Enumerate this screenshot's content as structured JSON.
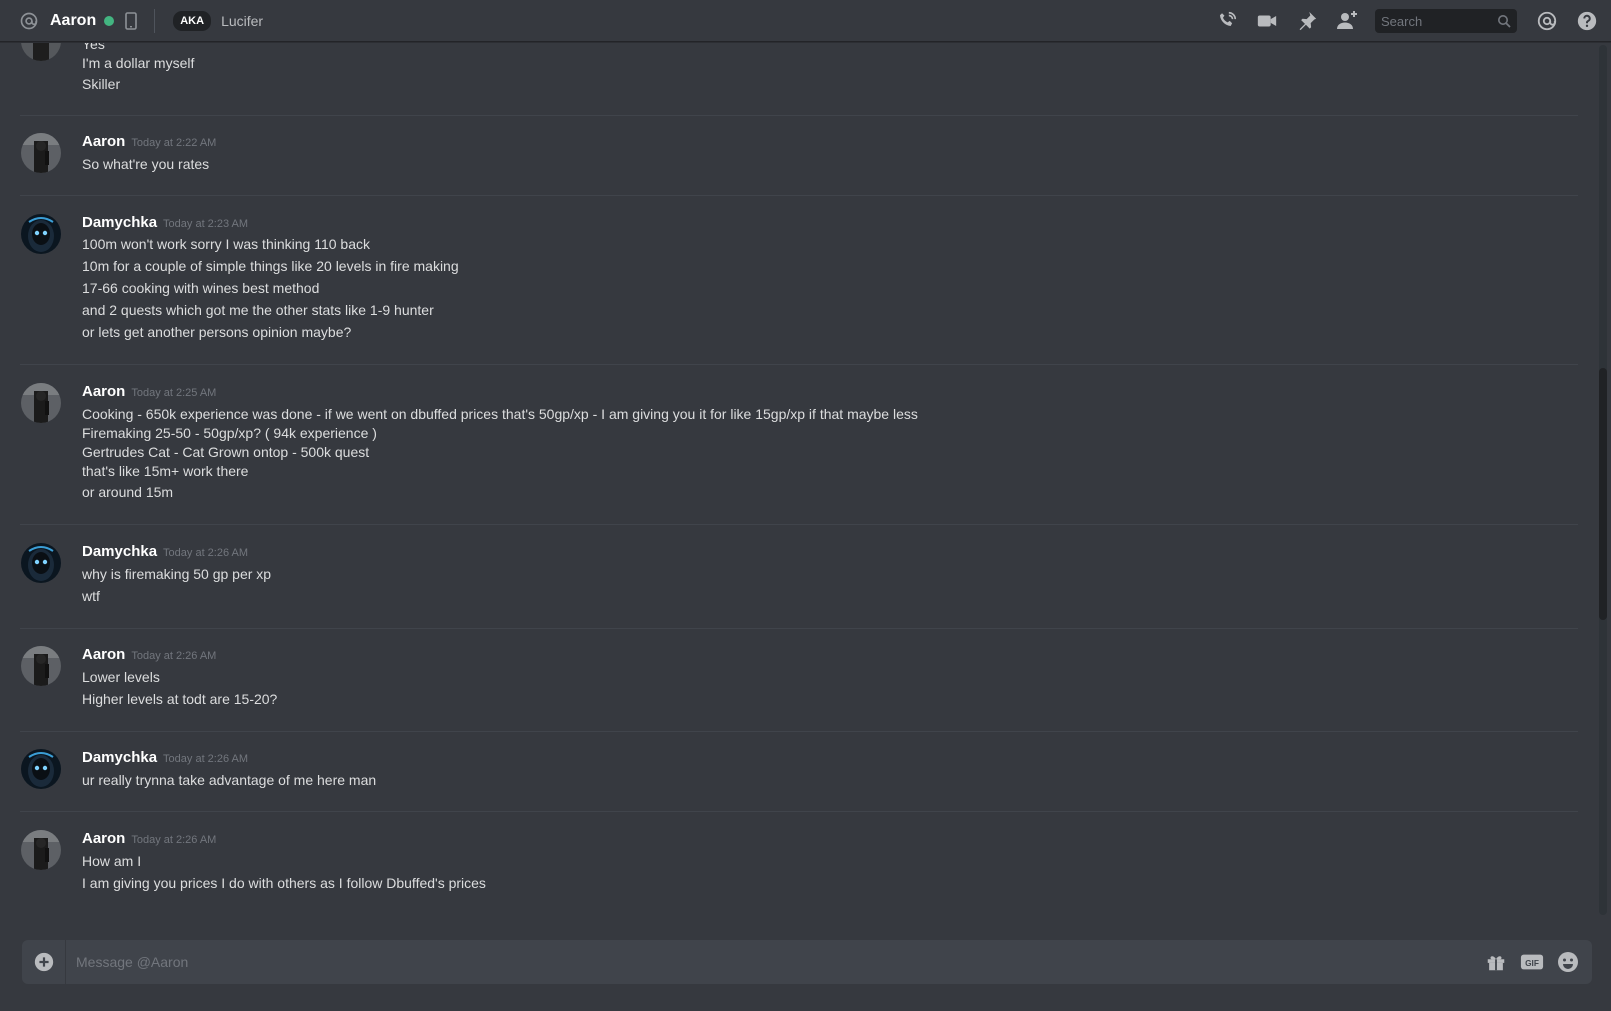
{
  "header": {
    "recipient": "Aaron",
    "status_color": "#43b581",
    "aka_label": "AKA",
    "aka_name": "Lucifer",
    "search_placeholder": "Search",
    "icons": [
      "at-icon",
      "mobile-icon",
      "voice-call-icon",
      "video-call-icon",
      "pin-icon",
      "add-friend-icon",
      "search-icon",
      "mention-icon",
      "help-icon"
    ]
  },
  "messages": [
    {
      "author": "",
      "timestamp": "",
      "lines": [
        "Yes",
        "I'm a dollar myself",
        "Skiller"
      ]
    },
    {
      "author": "Aaron",
      "timestamp": "Today at 2:22 AM",
      "lines": [
        "So what're you rates"
      ]
    },
    {
      "author": "Damychka",
      "timestamp": "Today at 2:23 AM",
      "lines": [
        "100m won't work sorry I was thinking 110 back",
        "10m for a couple of simple things like 20 levels in fire making",
        "17-66 cooking with wines best method",
        "and 2 quests which got me the other stats like 1-9 hunter",
        "or lets get another persons opinion maybe?"
      ]
    },
    {
      "author": "Aaron",
      "timestamp": "Today at 2:25 AM",
      "lines": [
        "Cooking - 650k experience was done - if we went on dbuffed prices that's 50gp/xp - I am giving you it for like 15gp/xp if that maybe less",
        "Firemaking 25-50 - 50gp/xp? ( 94k experience )",
        "Gertrudes Cat - Cat Grown ontop - 500k quest",
        "that's like 15m+ work there",
        "or around 15m"
      ]
    },
    {
      "author": "Damychka",
      "timestamp": "Today at 2:26 AM",
      "lines": [
        "why is firemaking 50 gp per xp",
        "wtf"
      ]
    },
    {
      "author": "Aaron",
      "timestamp": "Today at 2:26 AM",
      "lines": [
        "Lower levels",
        "Higher levels at todt are 15-20?"
      ]
    },
    {
      "author": "Damychka",
      "timestamp": "Today at 2:26 AM",
      "lines": [
        "ur really trynna take advantage of me here man"
      ]
    },
    {
      "author": "Aaron",
      "timestamp": "Today at 2:26 AM",
      "lines": [
        "How am I",
        "I am giving you prices I do with others as I follow Dbuffed's prices"
      ]
    }
  ],
  "composer": {
    "placeholder": "Message @Aaron",
    "icons": [
      "attach-icon",
      "gift-icon",
      "gif-icon",
      "emoji-icon"
    ]
  }
}
